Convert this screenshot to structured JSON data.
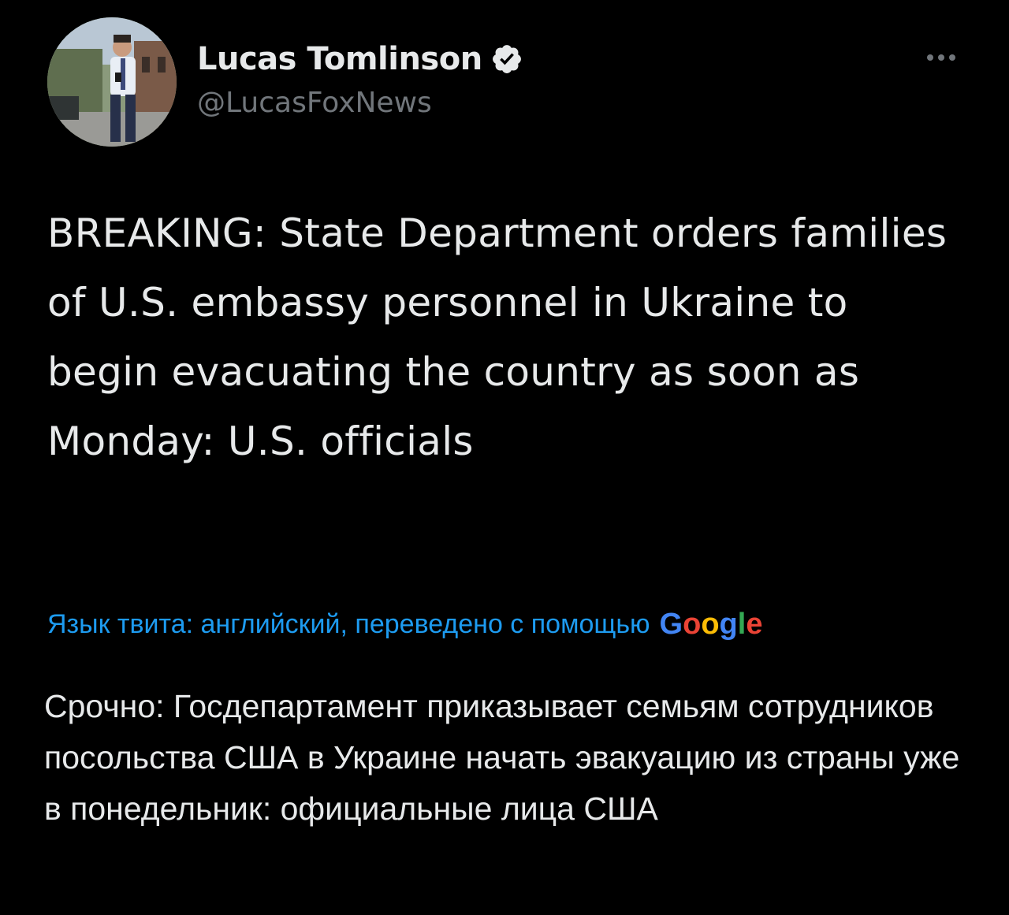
{
  "author": {
    "display_name": "Lucas Tomlinson",
    "handle": "@LucasFoxNews",
    "verified": true,
    "avatar_icon": "profile-photo-avatar"
  },
  "tweet": {
    "text": "BREAKING: State Department orders families of U.S. embassy personnel in Ukraine to begin evacuating the country as soon as Monday: U.S. officials"
  },
  "translation": {
    "label": "Язык твита: английский, переведено с помощью",
    "provider_logo_text": "Google",
    "text": "Срочно: Госдепартамент приказывает семьям сотрудников посольства США в Украине начать эвакуацию из страны уже в понедельник: официальные лица США"
  },
  "icons": {
    "verified": "verified-badge-icon",
    "more": "more-options-icon"
  },
  "colors": {
    "background": "#000000",
    "primary_text": "#e7e9ea",
    "secondary_text": "#71767b",
    "link": "#1d9bf0",
    "google_blue": "#4285f4",
    "google_red": "#ea4335",
    "google_yellow": "#fbbc05",
    "google_green": "#34a853"
  }
}
